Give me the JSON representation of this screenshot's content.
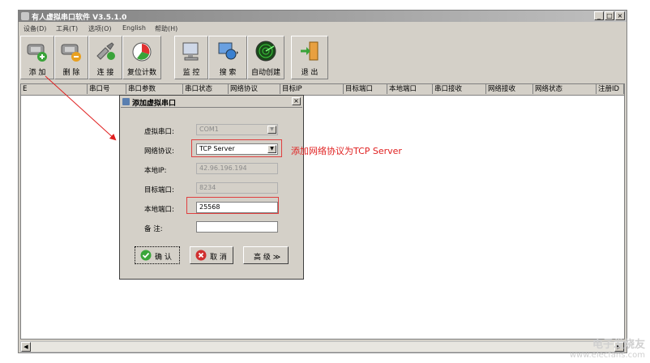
{
  "window": {
    "title": "有人虚拟串口软件 V3.5.1.0",
    "controls": [
      "_",
      "□",
      "×"
    ]
  },
  "menu": [
    "设备(D)",
    "工具(T)",
    "选项(O)",
    "English",
    "帮助(H)"
  ],
  "toolbar": {
    "add": "添 加",
    "delete": "删 除",
    "connect": "连 接",
    "reset_count": "复位计数",
    "monitor": "监 控",
    "search": "搜 索",
    "auto_create": "自动创建",
    "exit": "退 出"
  },
  "table": {
    "columns": [
      "E",
      "串口号",
      "串口参数",
      "串口状态",
      "网络协议",
      "目标IP",
      "目标端口",
      "本地端口",
      "串口接收",
      "网络接收",
      "网络状态",
      "注册ID"
    ]
  },
  "dialog": {
    "title": "添加虚拟串口",
    "virtual_port_label": "虚拟串口:",
    "virtual_port_value": "COM1",
    "protocol_label": "网络协议:",
    "protocol_value": "TCP Server",
    "local_ip_label": "本地IP:",
    "local_ip_value": "42.96.196.194",
    "target_port_label": "目标端口:",
    "target_port_value": "8234",
    "local_port_label": "本地端口:",
    "local_port_value": "25568",
    "note_label": "备 注:",
    "note_value": "",
    "ok": "确 认",
    "cancel": "取 消",
    "advanced": "高 级 ≫"
  },
  "annotation": "添加网络协议为TCP Server",
  "watermark": {
    "line1": "电子发烧友",
    "line2": "www.elecfans.com"
  },
  "colors": {
    "annotation_red": "#e02020",
    "ok_green": "#3aa63a",
    "cancel_red": "#d03030"
  }
}
